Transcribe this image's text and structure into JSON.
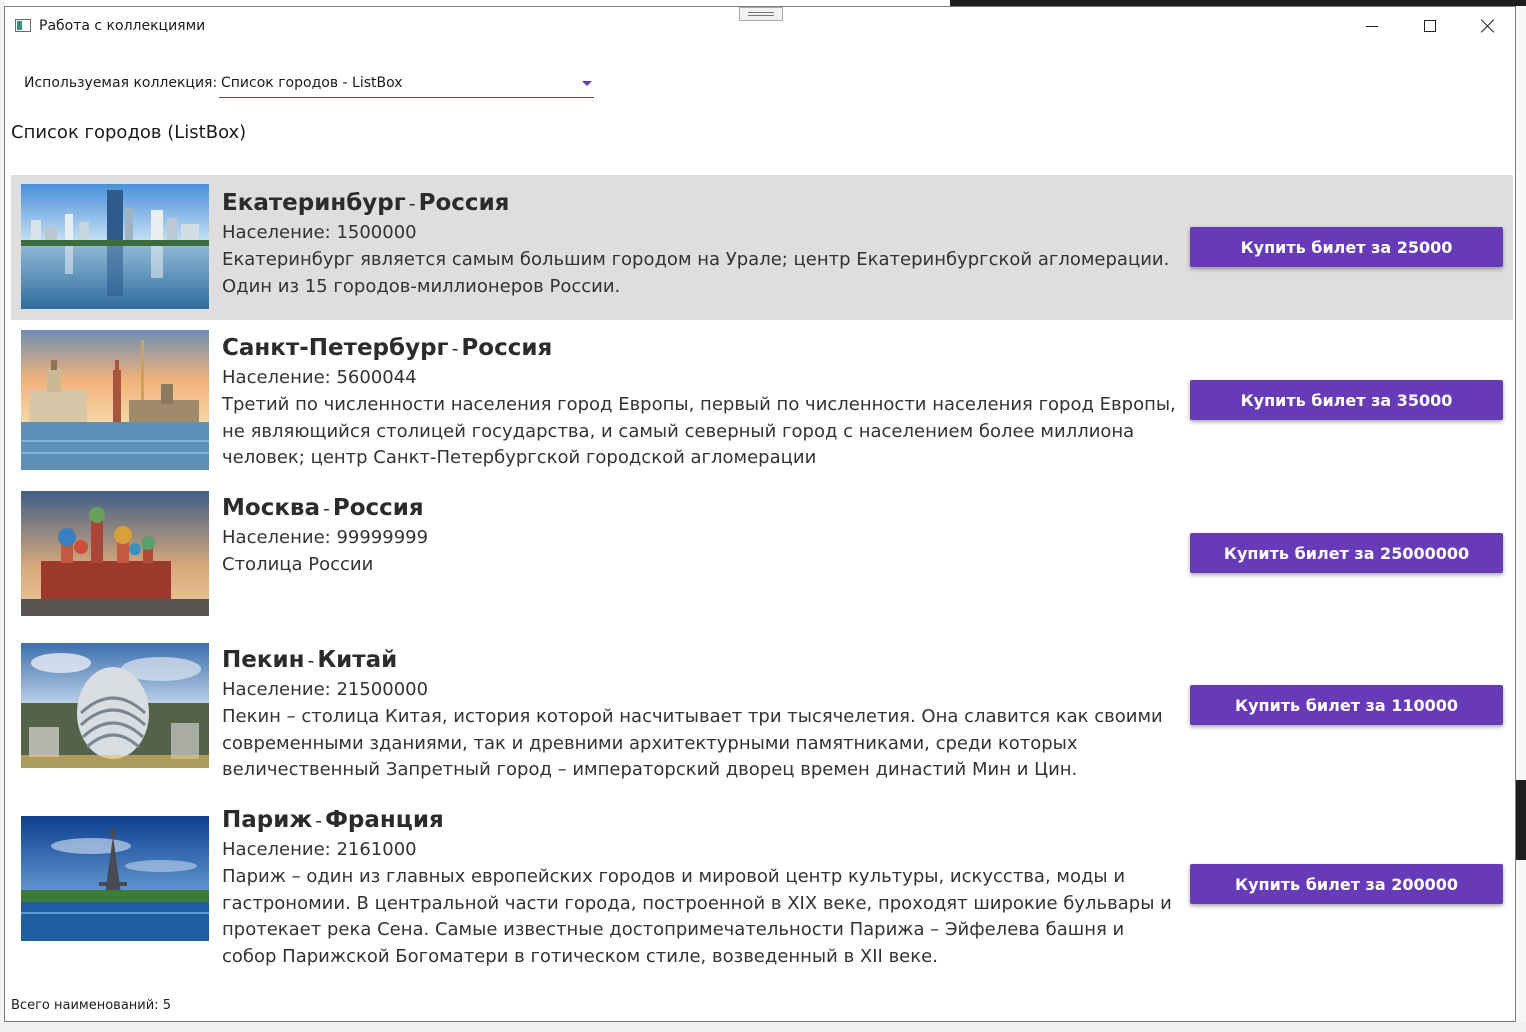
{
  "window": {
    "title": "Работа с коллекциями"
  },
  "collection": {
    "label": "Используемая коллекция:",
    "selected": "Список городов - ListBox"
  },
  "heading": "Список городов (ListBox)",
  "cities": [
    {
      "name": "Екатеринбург",
      "sep": "-",
      "country": "Россия",
      "population": "Население: 1500000",
      "description": "Екатеринбург является самым большим городом на Урале; центр Екатеринбургской агломерации. Один из 15 городов-миллионеров России.",
      "button": "Купить билет за 25000",
      "image": "yekaterinburg-photo"
    },
    {
      "name": "Санкт-Петербург",
      "sep": "-",
      "country": "Россия",
      "population": "Население: 5600044",
      "description": "Третий по численности населения город Европы, первый по численности населения город Европы, не являющийся столицей государства, и самый северный город с населением более миллиона человек; центр Санкт-Петербургской городской агломерации",
      "button": "Купить билет за 35000",
      "image": "saint-petersburg-photo"
    },
    {
      "name": "Москва",
      "sep": "-",
      "country": "Россия",
      "population": "Население: 99999999",
      "description": "Столица России",
      "button": "Купить билет за 25000000",
      "image": "moscow-photo"
    },
    {
      "name": "Пекин",
      "sep": "-",
      "country": "Китай",
      "population": "Население: 21500000",
      "description": "Пекин – столица Китая, история которой насчитывает три тысячелетия. Она славится как своими современными зданиями, так и древними архитектурными памятниками, среди которых величественный Запретный город – императорский дворец времен династий Мин и Цин.",
      "button": "Купить билет за 110000",
      "image": "beijing-photo"
    },
    {
      "name": "Париж",
      "sep": "-",
      "country": "Франция",
      "population": "Население: 2161000",
      "description": "Париж – один из главных европейских городов и мировой центр культуры, искусства, моды и гастрономии. В центральной части города, построенной в XIX веке, проходят широкие бульвары и протекает река Сена. Самые известные достопримечательности Парижа – Эйфелева башня и собор Парижской Богоматери в готическом стиле, возведенный в XII веке.",
      "button": "Купить билет за 200000",
      "image": "paris-photo"
    }
  ],
  "footer": "Всего наименований: 5",
  "colors": {
    "accent": "#673ab7",
    "selected_row": "#dedede"
  }
}
